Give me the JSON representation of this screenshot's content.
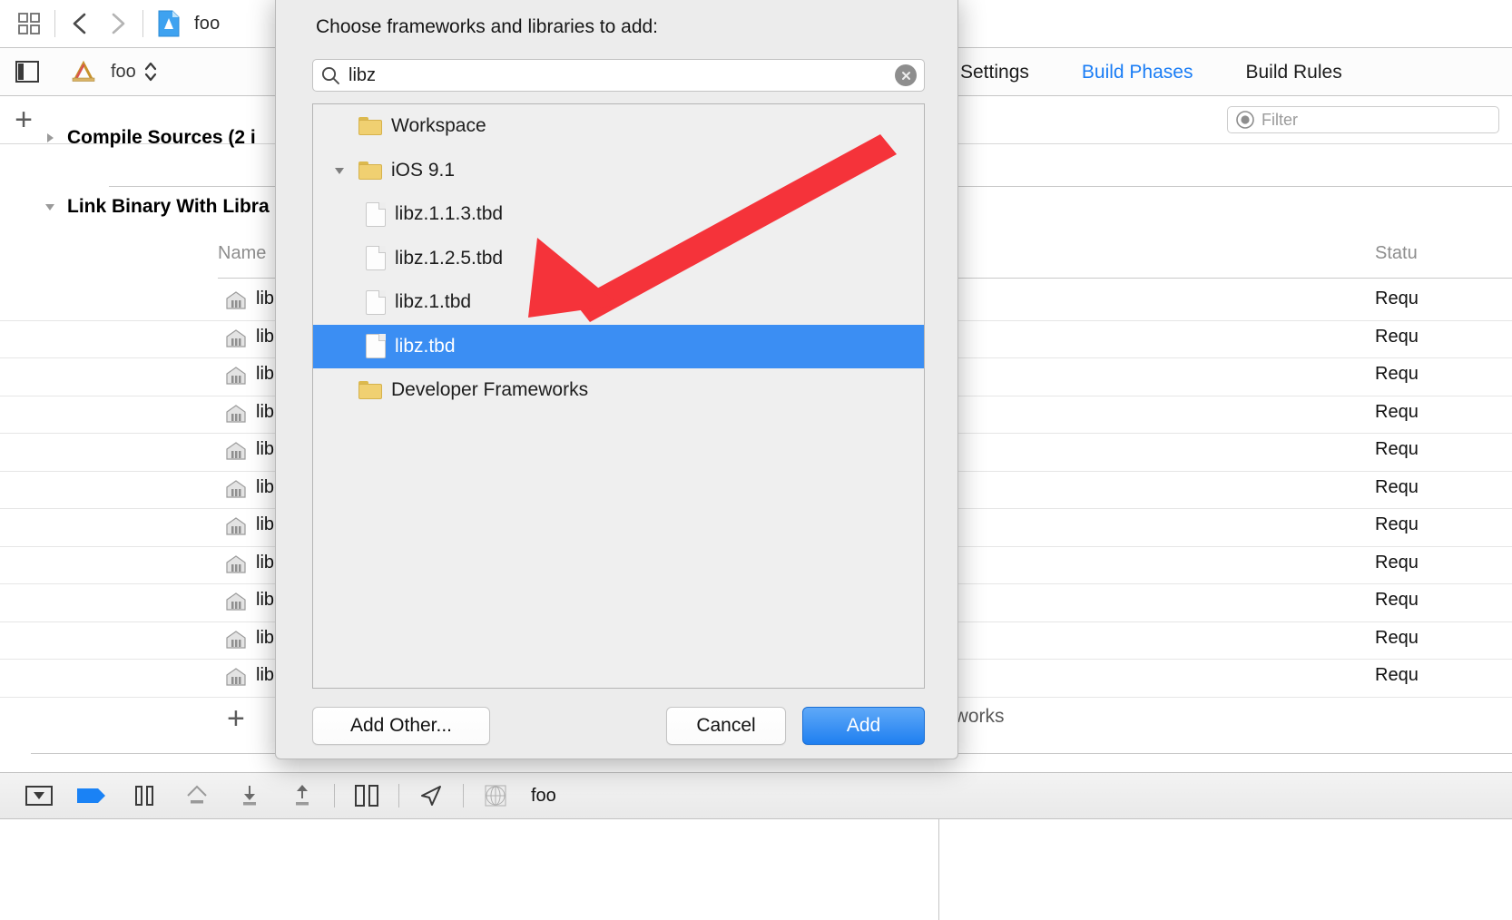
{
  "window": {
    "toolbar": {
      "project_name": "foo",
      "icons": [
        "grid-icon",
        "back-chevron-icon",
        "forward-chevron-icon",
        "app-document-icon"
      ]
    },
    "jumpbar": {
      "sidebar_toggle": "sidebar-toggle-icon",
      "scheme_icon": "xcode-ruler-icon",
      "scheme_name": "foo",
      "stepper": "stepper-icon"
    },
    "tabs": [
      {
        "label": "Settings",
        "active": false
      },
      {
        "label": "Build Phases",
        "active": true
      },
      {
        "label": "Build Rules",
        "active": false
      }
    ],
    "filter": {
      "placeholder": "Filter",
      "value": ""
    },
    "add_phase_label": "+",
    "phases": [
      {
        "title": "Compile Sources (2 i",
        "expanded": false
      },
      {
        "title": "Link Binary With Libra",
        "expanded": true
      }
    ],
    "table": {
      "columns": [
        "Name",
        "Statu"
      ],
      "rows": [
        {
          "name": "lib",
          "status": "Requ"
        },
        {
          "name": "lib",
          "status": "Requ"
        },
        {
          "name": "lib",
          "status": "Requ"
        },
        {
          "name": "lib",
          "status": "Requ"
        },
        {
          "name": "lib",
          "status": "Requ"
        },
        {
          "name": "lib",
          "status": "Requ"
        },
        {
          "name": "lib",
          "status": "Requ"
        },
        {
          "name": "lib",
          "status": "Requ"
        },
        {
          "name": "lib",
          "status": "Requ"
        },
        {
          "name": "lib",
          "status": "Requ"
        },
        {
          "name": "lib",
          "status": "Requ"
        }
      ]
    },
    "add_library_label": "+",
    "embed_frameworks_text": "eworks",
    "bottom_bar": {
      "icons": [
        "show-debug-area-icon",
        "breakpoint-icon",
        "pause-icon",
        "step-over-icon",
        "step-into-icon",
        "step-out-icon",
        "debug-view-hierarchy-icon",
        "location-icon",
        "memory-graph-icon"
      ],
      "label": "foo"
    }
  },
  "sheet": {
    "title": "Choose frameworks and libraries to add:",
    "search": {
      "value": "libz",
      "placeholder": "",
      "icon": "search-icon",
      "clear_icon": "clear-icon"
    },
    "tree": [
      {
        "label": "Workspace",
        "kind": "folder",
        "indent": 1,
        "twisty": "none",
        "selected": false
      },
      {
        "label": "iOS 9.1",
        "kind": "folder",
        "indent": 1,
        "twisty": "expanded",
        "selected": false
      },
      {
        "label": "libz.1.1.3.tbd",
        "kind": "document",
        "indent": 2,
        "twisty": "none",
        "selected": false
      },
      {
        "label": "libz.1.2.5.tbd",
        "kind": "document",
        "indent": 2,
        "twisty": "none",
        "selected": false
      },
      {
        "label": "libz.1.tbd",
        "kind": "document",
        "indent": 2,
        "twisty": "none",
        "selected": false
      },
      {
        "label": "libz.tbd",
        "kind": "document",
        "indent": 2,
        "twisty": "none",
        "selected": true
      },
      {
        "label": "Developer Frameworks",
        "kind": "folder",
        "indent": 1,
        "twisty": "none",
        "selected": false
      }
    ],
    "buttons": {
      "add_other": "Add Other...",
      "cancel": "Cancel",
      "add": "Add"
    }
  },
  "annotation": {
    "shape": "red-arrow",
    "color": "#f5333a",
    "points_at": "libz.tbd"
  },
  "colors": {
    "accent_blue": "#1a7df5",
    "selection_blue": "#3b8ef3",
    "annotation_red": "#f5333a",
    "sheet_bg": "#ececec",
    "folder_yellow": "#f0d071"
  }
}
